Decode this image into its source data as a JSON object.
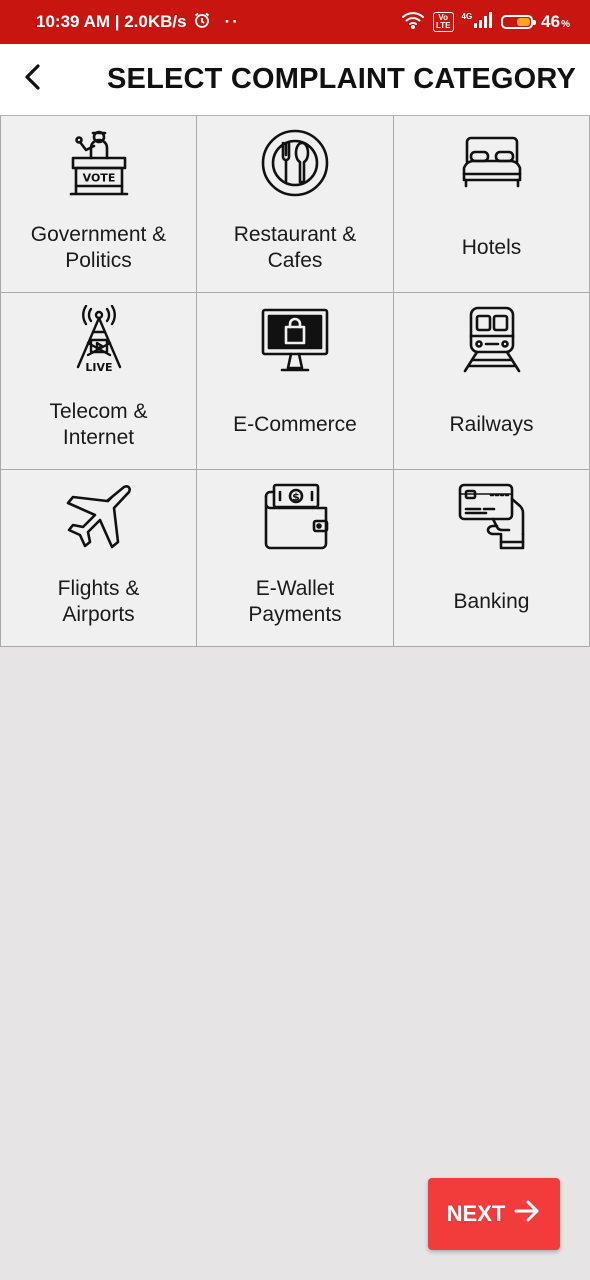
{
  "status_bar": {
    "time_speed": "10:39 AM | 2.0KB/s",
    "dots": "··",
    "volte_top": "Vo",
    "volte_bottom": "LTE",
    "network": "4G",
    "battery_percent": "46",
    "battery_sign": "%",
    "battery_level": 0.46
  },
  "header": {
    "title": "SELECT COMPLAINT CATEGORY"
  },
  "categories": [
    {
      "label": "Government &\nPolitics",
      "icon": "vote-booth-icon"
    },
    {
      "label": "Restaurant &\nCafes",
      "icon": "plate-cutlery-icon"
    },
    {
      "label": "Hotels",
      "icon": "bed-icon"
    },
    {
      "label": "Telecom &\nInternet",
      "icon": "live-tower-icon"
    },
    {
      "label": "E-Commerce",
      "icon": "monitor-shopping-bag-icon"
    },
    {
      "label": "Railways",
      "icon": "train-icon"
    },
    {
      "label": "Flights &\nAirports",
      "icon": "airplane-icon"
    },
    {
      "label": "E-Wallet\nPayments",
      "icon": "wallet-icon"
    },
    {
      "label": "Banking",
      "icon": "card-in-hand-icon"
    }
  ],
  "next_button": {
    "label": "NEXT",
    "icon": "arrow-right-icon"
  },
  "colors": {
    "status_bar": "#c9150f",
    "next_button": "#f23c3c",
    "background": "#e6e4e5",
    "cell": "#f0f0f0"
  }
}
